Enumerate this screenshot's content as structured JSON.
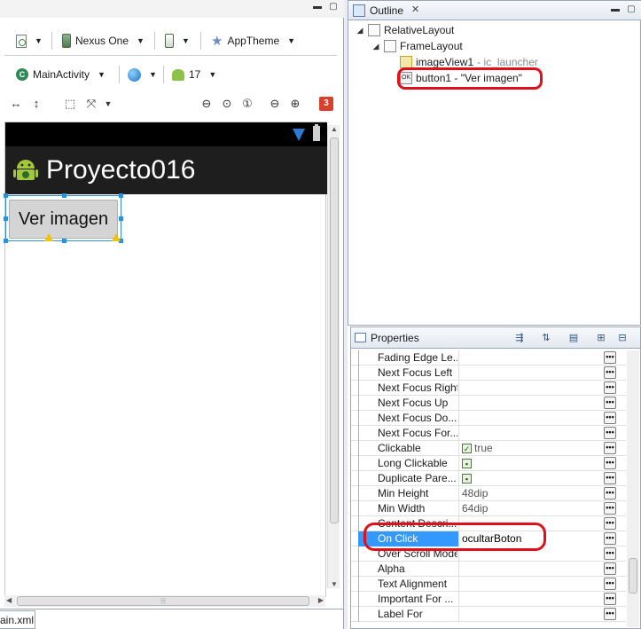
{
  "editor": {
    "toolbar1": {
      "device": "Nexus One",
      "theme": "AppTheme"
    },
    "toolbar2": {
      "activity": "MainActivity",
      "api_level": "17"
    },
    "error_count": "3",
    "file_tab": "ain.xml",
    "preview": {
      "app_title": "Proyecto016",
      "button_label": "Ver imagen"
    }
  },
  "outline": {
    "tab_title": "Outline",
    "tree": [
      {
        "label": "RelativeLayout",
        "sub": ""
      },
      {
        "label": "FrameLayout",
        "sub": ""
      },
      {
        "label": "imageView1",
        "sub": "- ic_launcher"
      },
      {
        "label": "button1 - \"Ver imagen\"",
        "sub": ""
      }
    ]
  },
  "properties": {
    "tab_title": "Properties",
    "rows": [
      {
        "name": "Fading Edge Le...",
        "value": ""
      },
      {
        "name": "Next Focus Left",
        "value": ""
      },
      {
        "name": "Next Focus Right",
        "value": ""
      },
      {
        "name": "Next Focus Up",
        "value": ""
      },
      {
        "name": "Next Focus Do...",
        "value": ""
      },
      {
        "name": "Next Focus For...",
        "value": ""
      },
      {
        "name": "Clickable",
        "value": "true"
      },
      {
        "name": "Long Clickable",
        "value": ""
      },
      {
        "name": "Duplicate Pare...",
        "value": ""
      },
      {
        "name": "Min Height",
        "value": "48dip"
      },
      {
        "name": "Min Width",
        "value": "64dip"
      },
      {
        "name": "Content Descri...",
        "value": ""
      },
      {
        "name": "On Click",
        "value": "ocultarBoton"
      },
      {
        "name": "Over Scroll Mode",
        "value": ""
      },
      {
        "name": "Alpha",
        "value": ""
      },
      {
        "name": "Text Alignment",
        "value": ""
      },
      {
        "name": "Important For ...",
        "value": ""
      },
      {
        "name": "Label For",
        "value": ""
      }
    ]
  },
  "colors": {
    "selection": "#3399ff",
    "annotation": "#e0101a",
    "action_bar": "#1e1e1e"
  }
}
